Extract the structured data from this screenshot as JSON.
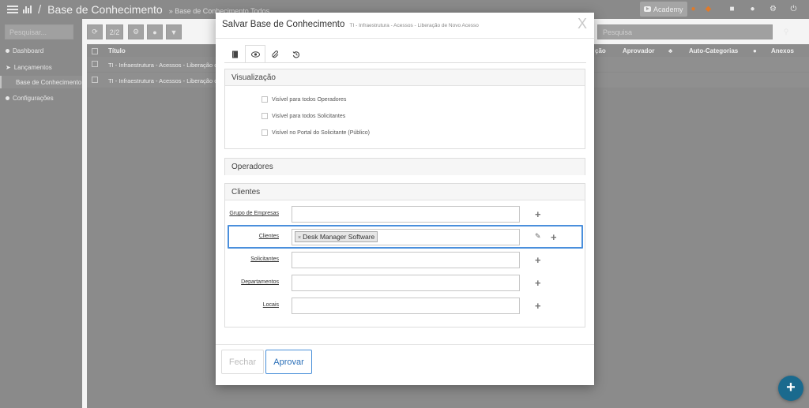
{
  "app": {
    "page_title": "Base de Conhecimento",
    "breadcrumb": "» Base de Conhecimento Todos",
    "academy_label": "Academy"
  },
  "sidebar": {
    "search_placeholder": "Pesquisar...",
    "items": [
      {
        "label": "Dashboard"
      },
      {
        "label": "Lançamentos"
      },
      {
        "label": "Base de Conhecimento"
      },
      {
        "label": "Configurações"
      }
    ]
  },
  "toolbar": {
    "paging": "2/2",
    "search_placeholder": "Pesquisa"
  },
  "grid": {
    "columns": {
      "title": "Título",
      "tracao": "ção",
      "aprovador": "Aprovador",
      "autocat": "Auto-Categorias",
      "anexos": "Anexos"
    },
    "rows": [
      {
        "title": "TI - Infraestrutura - Acessos - Liberação de Nov"
      },
      {
        "title": "TI - Infraestrutura - Acessos - Liberação de Nov"
      }
    ]
  },
  "modal": {
    "title": "Salvar Base de Conhecimento",
    "subtitle": "TI - Infraestrutura - Acessos - Liberação de Novo Acesso",
    "close": "X",
    "visualizacao": {
      "heading": "Visualização",
      "options": [
        {
          "label": "Visível para todos Operadores",
          "checked": false
        },
        {
          "label": "Visível para todos Solicitantes",
          "checked": false
        },
        {
          "label": "Visível no Portal do Solicitante (Público)",
          "checked": false
        }
      ]
    },
    "operadores": {
      "heading": "Operadores"
    },
    "clientes": {
      "heading": "Clientes",
      "fields": [
        {
          "label": "Grupo de Empresas",
          "value": ""
        },
        {
          "label": "Clientes",
          "tag": "Desk Manager Software"
        },
        {
          "label": "Solicitantes",
          "value": ""
        },
        {
          "label": "Departamentos",
          "value": ""
        },
        {
          "label": "Locais",
          "value": ""
        }
      ],
      "tag_remove": "×"
    },
    "buttons": {
      "close": "Fechar",
      "approve": "Aprovar"
    }
  },
  "fab_label": "+"
}
